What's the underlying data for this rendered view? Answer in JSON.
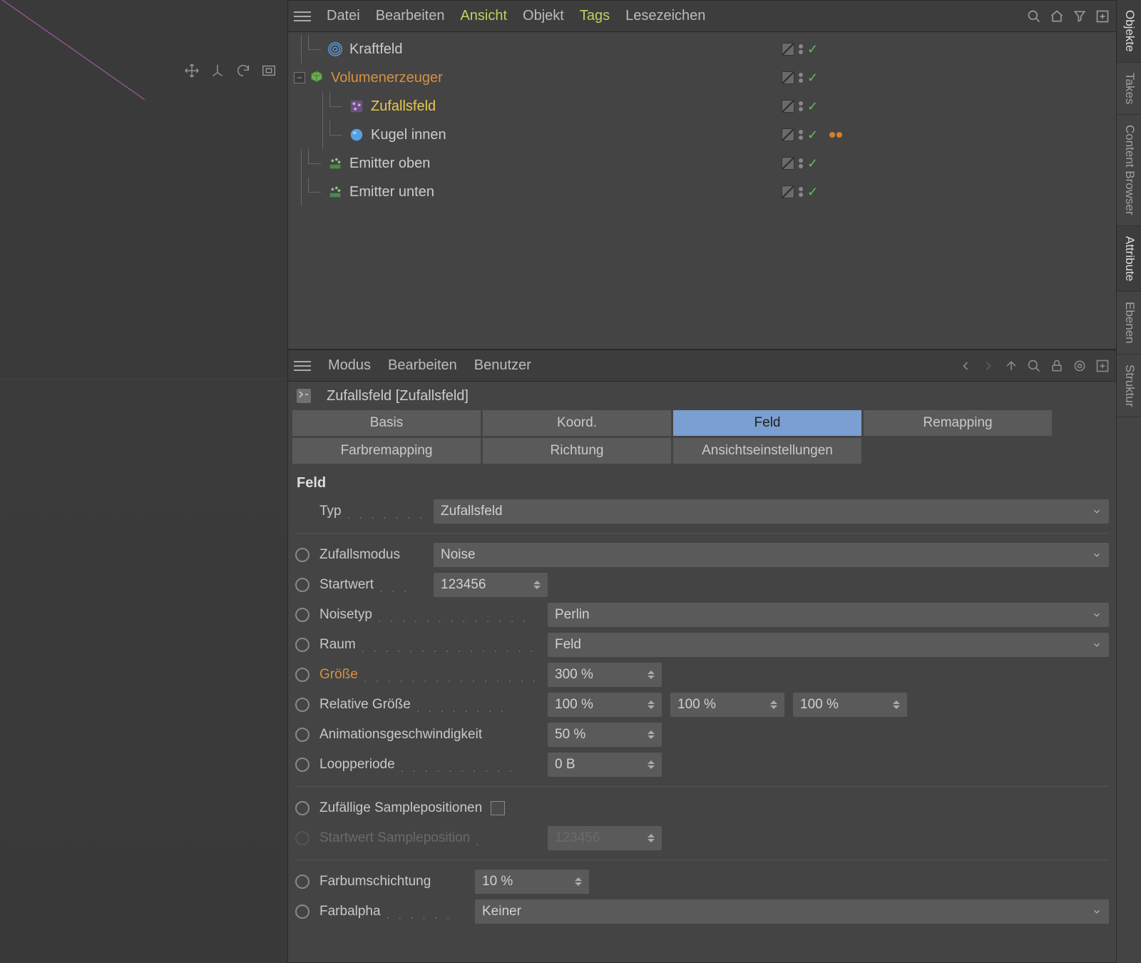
{
  "sideTabs": [
    "Objekte",
    "Takes",
    "Content Browser",
    "Attribute",
    "Ebenen",
    "Struktur"
  ],
  "objectManager": {
    "menu": [
      "Datei",
      "Bearbeiten",
      "Ansicht",
      "Objekt",
      "Tags",
      "Lesezeichen"
    ],
    "tree": {
      "kraftfeld": "Kraftfeld",
      "volumenerzeuger": "Volumenerzeuger",
      "zufallsfeld": "Zufallsfeld",
      "kugelInnen": "Kugel innen",
      "emitterOben": "Emitter oben",
      "emitterUnten": "Emitter unten"
    }
  },
  "attributeManager": {
    "menu": [
      "Modus",
      "Bearbeiten",
      "Benutzer"
    ],
    "title": "Zufallsfeld [Zufallsfeld]",
    "tabs": [
      "Basis",
      "Koord.",
      "Feld",
      "Remapping",
      "Farbremapping",
      "Richtung",
      "Ansichtseinstellungen"
    ],
    "section": "Feld",
    "params": {
      "typ": {
        "label": "Typ",
        "value": "Zufallsfeld"
      },
      "zufallsmodus": {
        "label": "Zufallsmodus",
        "value": "Noise"
      },
      "startwert": {
        "label": "Startwert",
        "value": "123456"
      },
      "noisetyp": {
        "label": "Noisetyp",
        "value": "Perlin"
      },
      "raum": {
        "label": "Raum",
        "value": "Feld"
      },
      "groesse": {
        "label": "Größe",
        "value": "300 %"
      },
      "relativeGroesse": {
        "label": "Relative Größe",
        "x": "100 %",
        "y": "100 %",
        "z": "100 %"
      },
      "animationsgeschwindigkeit": {
        "label": "Animationsgeschwindigkeit",
        "value": "50 %"
      },
      "loopperiode": {
        "label": "Loopperiode",
        "value": "0 B"
      },
      "zufaelligeSamplepositionen": {
        "label": "Zufällige Samplepositionen",
        "checked": false
      },
      "startwertSampleposition": {
        "label": "Startwert Sampleposition",
        "value": "123456"
      },
      "farbumschichtung": {
        "label": "Farbumschichtung",
        "value": "10 %"
      },
      "farbalpha": {
        "label": "Farbalpha",
        "value": "Keiner"
      }
    }
  }
}
